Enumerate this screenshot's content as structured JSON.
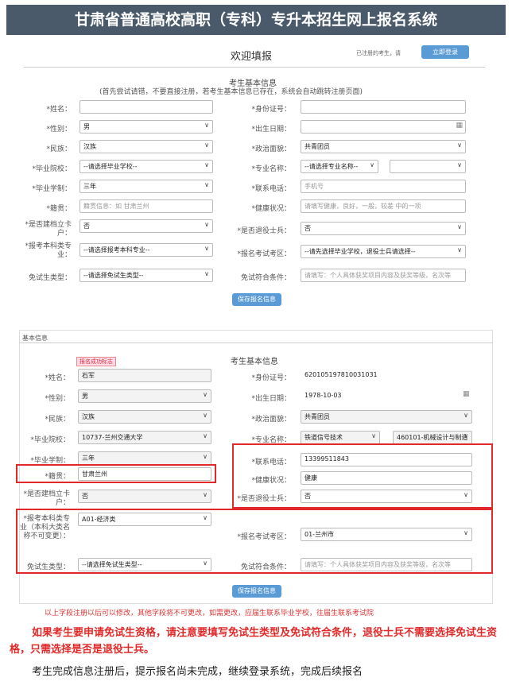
{
  "title": "甘肃省普通高校高职（专科）专升本招生网上报名系统",
  "top": {
    "welcome": "欢迎填报",
    "notice": "已注册的考生，请",
    "login_btn": "立即登录",
    "section_title": "考生基本信息",
    "section_sub": "(首先尝试请错，不要直接注册，若考生基本信息已存在，系统会自动跳转注册页面)",
    "fields": {
      "name": "*姓名：",
      "idcard": "*身份证号：",
      "gender": "*性别：",
      "gender_val": "男",
      "birth": "*出生日期：",
      "nation": "*民族：",
      "nation_val": "汉族",
      "politics": "*政治面貌：",
      "politics_val": "共青团员",
      "school": "*毕业院校：",
      "school_val": "--请选择毕业学校--",
      "major": "*专业名称：",
      "major_val": "--请选择专业名称--",
      "edu": "*毕业学制：",
      "edu_val": "三年",
      "phone": "*联系电话：",
      "phone_ph": "手机号",
      "origin": "*籍贯：",
      "origin_ph": "籍贯信息：如 甘肃兰州",
      "health": "*健康状况：",
      "health_ph": "请填写健康，良好，一般，较差 中的一项",
      "retired": "*是否建档立卡户：",
      "retired_val": "否",
      "soldier": "*是否退役士兵：",
      "soldier_val": "否",
      "apply_major": "*报考本科类专业：",
      "apply_major_val": "--请选择报考本科专业--",
      "exam_area": "*报名考试考区：",
      "exam_area_val": "--请先选择毕业学校，退役士兵请选择--",
      "free_type": "免试生类型：",
      "free_type_val": "--请选择免试生类型--",
      "free_cond": "免试符合条件：",
      "free_cond_ph": "请填写：个人具体获奖项目内容及获奖等级，名次等"
    },
    "save_btn": "保存报名信息"
  },
  "bottom": {
    "header": "基本信息",
    "tag": "报名成功标志",
    "section_title": "考生基本信息",
    "fields": {
      "name": "*姓名：",
      "name_val": "石军",
      "idcard": "*身份证号：",
      "idcard_val": "620105197810031031",
      "gender": "*性别：",
      "gender_val": "男",
      "birth": "*出生日期：",
      "birth_val": "1978-10-03",
      "nation": "*民族：",
      "nation_val": "汉族",
      "politics": "*政治面貌：",
      "politics_val": "共青团员",
      "school": "*毕业院校：",
      "school_val": "10737-兰州交通大学",
      "major": "*专业名称：",
      "major_val": "铁道信号技术",
      "major2_val": "460101-机械设计与制造",
      "edu": "*毕业学制：",
      "edu_val": "三年",
      "phone": "*联系电话：",
      "phone_val": "13399511843",
      "origin": "*籍贯：",
      "origin_val": "甘肃兰州",
      "health": "*健康状况：",
      "health_val": "健康",
      "archive": "*是否建档立卡户：",
      "archive_val": "否",
      "soldier": "*是否退役士兵：",
      "soldier_val": "否",
      "apply_major": "*报考本科类专业（本科大类名称不可变更）：",
      "apply_major_val": "A01-经济类",
      "exam_area": "*报名考试考区：",
      "exam_area_val": "01-兰州市",
      "free_type": "免试生类型：",
      "free_type_val": "--请选择免试生类型--",
      "free_cond": "免试符合条件：",
      "free_cond_ph": "请填写：个人具体获奖项目内容及获奖等级，名次等"
    },
    "save_btn": "保存报名信息",
    "red_note": "以上字段注册以后可以修改，其他字段将不可更改，如需更改，应届生联系毕业学校，往届生联系考试院"
  },
  "notes": {
    "bold_red": "如果考生要申请免试生资格，请注意要填写免试生类型及免试符合条件，退役士兵不需要选择免试生资格，只需选择是否是退役士兵。",
    "plain": "考生完成信息注册后，提示报名尚未完成，继续登录系统，完成后续报名"
  },
  "colors": {
    "title_bg": "#4a5a6a",
    "accent": "#5b9bd5",
    "red": "#e02a2a"
  }
}
